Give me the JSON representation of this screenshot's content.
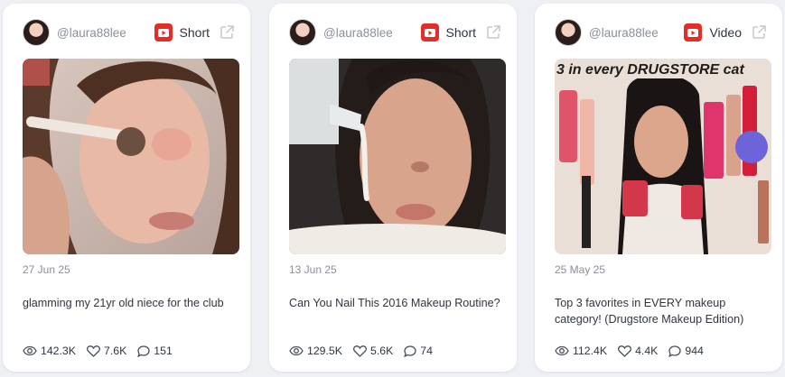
{
  "cards": [
    {
      "handle": "@laura88lee",
      "type": "Short",
      "date": "27 Jun 25",
      "title": "glamming my 21yr old niece for the club",
      "views": "142.3K",
      "likes": "7.6K",
      "comments": "151"
    },
    {
      "handle": "@laura88lee",
      "type": "Short",
      "date": "13 Jun 25",
      "title": "Can You Nail This 2016 Makeup Routine?",
      "views": "129.5K",
      "likes": "5.6K",
      "comments": "74"
    },
    {
      "handle": "@laura88lee",
      "type": "Video",
      "date": "25 May 25",
      "title": "Top 3 favorites in EVERY makeup category! (Drugstore Makeup Edition)",
      "views": "112.4K",
      "likes": "4.4K",
      "comments": "944",
      "thumb_text": "3 in every DRUGSTORE cat"
    }
  ],
  "icons": {
    "platform": "youtube-icon",
    "open": "external-link-icon",
    "views": "eye-icon",
    "likes": "heart-icon",
    "comments": "comment-icon"
  },
  "colors": {
    "youtube_red": "#e52d27",
    "muted": "#8a8f98",
    "text": "#2f3540"
  }
}
